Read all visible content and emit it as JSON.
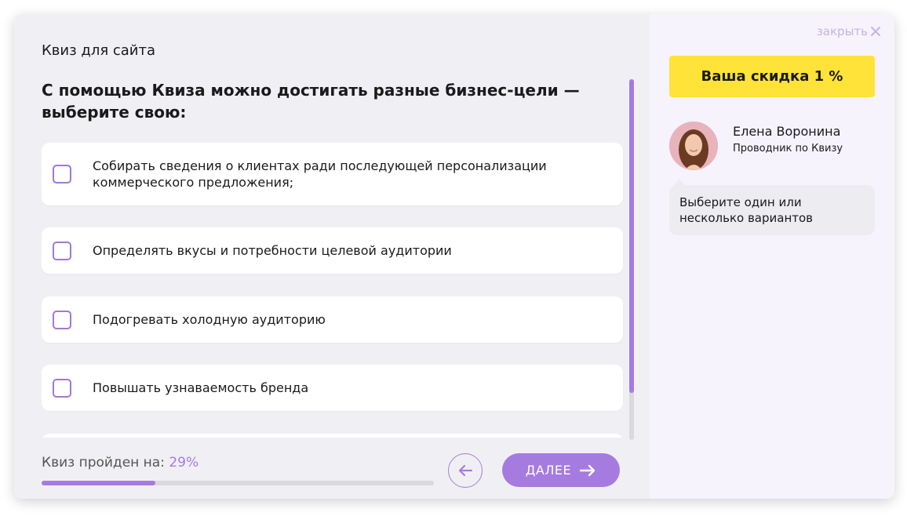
{
  "quiz": {
    "title": "Квиз для сайта",
    "question": "С помощью Квиза можно достигать разные бизнес-цели — выберите свою:",
    "options": [
      {
        "label": "Собирать сведения о клиентах ради последующей персонализации коммерческого предложения;",
        "checked": false
      },
      {
        "label": "Определять вкусы и потребности целевой аудитории",
        "checked": false
      },
      {
        "label": "Подогревать холодную аудиторию",
        "checked": false
      },
      {
        "label": "Повышать узнаваемость бренда",
        "checked": false
      }
    ]
  },
  "progress": {
    "label": "Квиз пройден на:",
    "value_text": "29%",
    "value": 0.29
  },
  "nav": {
    "back_icon": "arrow-left-icon",
    "next_label": "ДАЛЕЕ",
    "next_icon": "arrow-right-icon"
  },
  "sidebar": {
    "close_label": "закрыть",
    "close_icon": "close-icon",
    "discount_label": "Ваша скидка 1 %",
    "guide": {
      "name": "Елена Воронина",
      "role": "Проводник по Квизу",
      "avatar_icon": "avatar-photo"
    },
    "hint": "Выберите один или несколько вариантов"
  },
  "colors": {
    "accent": "#a67be0",
    "discount_bg": "#ffe338",
    "main_bg": "#f0f0f4",
    "side_bg": "#f6f3fc"
  }
}
